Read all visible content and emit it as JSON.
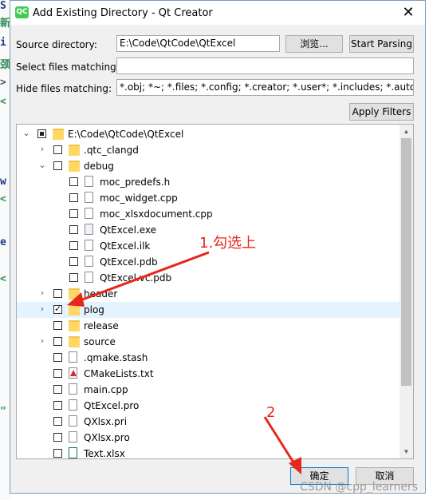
{
  "window": {
    "title": "Add Existing Directory - Qt Creator",
    "app_icon": "QC",
    "close_glyph": "✕"
  },
  "form": {
    "source_label": "Source directory:",
    "source_value": "E:\\Code\\QtCode\\QtExcel",
    "browse_label": "浏览...",
    "start_parsing_label": "Start Parsing",
    "select_label": "Select files matching:",
    "select_value": "",
    "hide_label": "Hide files matching:",
    "hide_value": "*.obj; *~; *.files; *.config; *.creator; *.user*; *.includes; *.autosave",
    "apply_filters_label": "Apply Filters"
  },
  "tree": {
    "rows": [
      {
        "label": "E:\\Code\\QtCode\\QtExcel",
        "arrow": "expanded",
        "check": "partial",
        "icon": "folder-icon"
      },
      {
        "label": ".qtc_clangd",
        "arrow": "collapsed",
        "check": "unchecked",
        "icon": "folder-icon"
      },
      {
        "label": "debug",
        "arrow": "expanded",
        "check": "unchecked",
        "icon": "folder-icon"
      },
      {
        "label": "moc_predefs.h",
        "check": "unchecked",
        "icon": "header-file-icon"
      },
      {
        "label": "moc_widget.cpp",
        "check": "unchecked",
        "icon": "cpp-file-icon"
      },
      {
        "label": "moc_xlsxdocument.cpp",
        "check": "unchecked",
        "icon": "cpp-file-icon"
      },
      {
        "label": "QtExcel.exe",
        "check": "unchecked",
        "icon": "exe-file-icon"
      },
      {
        "label": "QtExcel.ilk",
        "check": "unchecked",
        "icon": "binary-file-icon"
      },
      {
        "label": "QtExcel.pdb",
        "check": "unchecked",
        "icon": "pdb-file-icon"
      },
      {
        "label": "QtExcel.vc.pdb",
        "check": "unchecked",
        "icon": "pdb-file-icon"
      },
      {
        "label": "header",
        "arrow": "collapsed",
        "check": "unchecked",
        "icon": "folder-icon"
      },
      {
        "label": "plog",
        "arrow": "collapsed",
        "check": "checked",
        "icon": "folder-icon",
        "selected": true
      },
      {
        "label": "release",
        "check": "unchecked",
        "icon": "folder-icon"
      },
      {
        "label": "source",
        "arrow": "collapsed",
        "check": "unchecked",
        "icon": "folder-icon"
      },
      {
        "label": ".qmake.stash",
        "check": "unchecked",
        "icon": "text-file-icon"
      },
      {
        "label": "CMakeLists.txt",
        "check": "unchecked",
        "icon": "cmake-file-icon"
      },
      {
        "label": "main.cpp",
        "check": "unchecked",
        "icon": "cpp-file-icon"
      },
      {
        "label": "QtExcel.pro",
        "check": "unchecked",
        "icon": "pro-file-icon"
      },
      {
        "label": "QXlsx.pri",
        "check": "unchecked",
        "icon": "pro-file-icon"
      },
      {
        "label": "QXlsx.pro",
        "check": "unchecked",
        "icon": "pro-file-icon"
      },
      {
        "label": "Text.xlsx",
        "check": "unchecked",
        "icon": "excel-file-icon"
      }
    ]
  },
  "buttons": {
    "ok_label": "确定",
    "cancel_label": "取消"
  },
  "annotations": {
    "step1": "1.勾选上",
    "step2": "2",
    "color": "#e8261b"
  },
  "watermark": "CSDN @cpp_learners",
  "background_editor": {
    "glyphs": [
      "S",
      "新",
      "i",
      "颈",
      ">",
      "<",
      "w",
      "<",
      "e",
      "<",
      "\"",
      ")"
    ]
  }
}
